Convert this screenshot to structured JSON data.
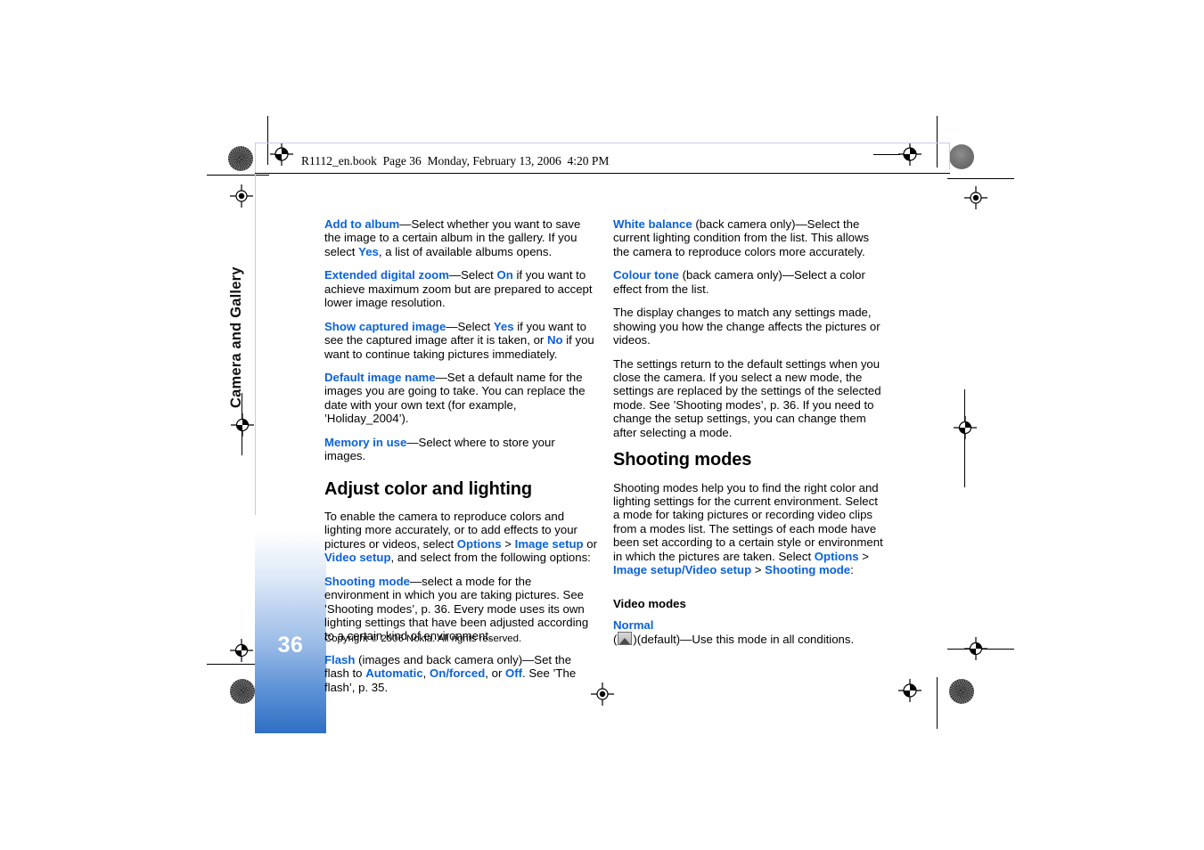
{
  "document": {
    "book_header": "R1112_en.book  Page 36  Monday, February 13, 2006  4:20 PM",
    "chapter_tab": "Camera and Gallery",
    "page_number": "36",
    "copyright": "Copyright © 2006 Nokia. All rights reserved.",
    "link_color": "#0a62dd",
    "accent_color": "#2f6fc4"
  },
  "left_column": {
    "paragraphs": [
      {
        "id": "add-to-album",
        "runs": [
          {
            "text": "Add to album",
            "style": "link"
          },
          {
            "text": "—Select whether you want to save the image to a certain album in the gallery. If you select ",
            "style": "plain"
          },
          {
            "text": "Yes",
            "style": "link"
          },
          {
            "text": ", a list of available albums opens.",
            "style": "plain"
          }
        ]
      },
      {
        "id": "extended-digital-zoom",
        "runs": [
          {
            "text": "Extended digital zoom",
            "style": "link"
          },
          {
            "text": "—Select ",
            "style": "plain"
          },
          {
            "text": "On",
            "style": "link"
          },
          {
            "text": " if you want to achieve maximum zoom but are prepared to accept lower image resolution.",
            "style": "plain"
          }
        ]
      },
      {
        "id": "show-captured-image",
        "runs": [
          {
            "text": "Show captured image",
            "style": "link"
          },
          {
            "text": "—Select ",
            "style": "plain"
          },
          {
            "text": "Yes",
            "style": "link"
          },
          {
            "text": " if you want to see the captured image after it is taken, or ",
            "style": "plain"
          },
          {
            "text": "No",
            "style": "link"
          },
          {
            "text": " if you want to continue taking pictures immediately.",
            "style": "plain"
          }
        ]
      },
      {
        "id": "default-image-name",
        "runs": [
          {
            "text": "Default image name",
            "style": "link"
          },
          {
            "text": "—Set a default name for the images you are going to take. You can replace the date with your own text (for example, ’Holiday_2004’).",
            "style": "plain"
          }
        ]
      },
      {
        "id": "memory-in-use",
        "runs": [
          {
            "text": "Memory in use",
            "style": "link"
          },
          {
            "text": "—Select where to store your images.",
            "style": "plain"
          }
        ]
      }
    ],
    "heading": "Adjust color and lighting",
    "paragraphs_after_heading": [
      {
        "id": "adjust-intro",
        "runs": [
          {
            "text": "To enable the camera to reproduce colors and lighting more accurately, or to add effects to your pictures or videos, select ",
            "style": "plain"
          },
          {
            "text": "Options",
            "style": "link"
          },
          {
            "text": " > ",
            "style": "plain"
          },
          {
            "text": "Image setup",
            "style": "link"
          },
          {
            "text": " or ",
            "style": "plain"
          },
          {
            "text": "Video setup",
            "style": "link"
          },
          {
            "text": ", and select from the following options:",
            "style": "plain"
          }
        ]
      },
      {
        "id": "shooting-mode",
        "runs": [
          {
            "text": "Shooting mode",
            "style": "link"
          },
          {
            "text": "—select a mode for the environment in which you are taking pictures. See ’Shooting modes’, p. 36. Every mode uses its own lighting settings that have been adjusted according to a certain kind of environment.",
            "style": "plain"
          }
        ]
      },
      {
        "id": "flash",
        "runs": [
          {
            "text": "Flash",
            "style": "link"
          },
          {
            "text": " (images and back camera only)—Set the flash to ",
            "style": "plain"
          },
          {
            "text": "Automatic",
            "style": "link"
          },
          {
            "text": ", ",
            "style": "plain"
          },
          {
            "text": "On/forced",
            "style": "link"
          },
          {
            "text": ", or ",
            "style": "plain"
          },
          {
            "text": "Off",
            "style": "link"
          },
          {
            "text": ". See ’The flash’, p. 35.",
            "style": "plain"
          }
        ]
      }
    ]
  },
  "right_column": {
    "paragraphs": [
      {
        "id": "white-balance",
        "runs": [
          {
            "text": "White balance",
            "style": "link"
          },
          {
            "text": " (back camera only)—Select the current lighting condition from the list. This allows the camera to reproduce colors more accurately.",
            "style": "plain"
          }
        ]
      },
      {
        "id": "colour-tone",
        "runs": [
          {
            "text": "Colour tone",
            "style": "link"
          },
          {
            "text": " (back camera only)—Select a color effect from the list.",
            "style": "plain"
          }
        ]
      },
      {
        "id": "display-changes",
        "runs": [
          {
            "text": "The display changes to match any settings made, showing you how the change affects the pictures or videos.",
            "style": "plain"
          }
        ]
      },
      {
        "id": "settings-return",
        "runs": [
          {
            "text": "The settings return to the default settings when you close the camera. If you select a new mode, the settings are replaced by the settings of the selected mode. See ’Shooting modes’, p. 36. If you need to change the setup settings, you can change them after selecting a mode.",
            "style": "plain"
          }
        ]
      }
    ],
    "heading": "Shooting modes",
    "paragraphs_after_heading": [
      {
        "id": "shooting-modes-intro",
        "runs": [
          {
            "text": "Shooting modes help you to find the right color and lighting settings for the current environment. Select a mode for taking pictures or recording video clips from a modes list. The settings of each mode have been set according to a certain style or environment in which the pictures are taken. Select ",
            "style": "plain"
          },
          {
            "text": "Options",
            "style": "link"
          },
          {
            "text": " > ",
            "style": "plain"
          },
          {
            "text": "Image setup",
            "style": "link"
          },
          {
            "text": "/",
            "style": "link"
          },
          {
            "text": "Video setup",
            "style": "link"
          },
          {
            "text": " > ",
            "style": "plain"
          },
          {
            "text": "Shooting mode",
            "style": "link"
          },
          {
            "text": ":",
            "style": "plain"
          }
        ]
      }
    ],
    "subheading": "Video modes",
    "mode_entries": [
      {
        "id": "normal-mode",
        "name": "Normal",
        "icon": "landscape-mode-icon",
        "before_icon": " (",
        "after_icon": ")(default)—Use this mode in all conditions."
      }
    ]
  }
}
